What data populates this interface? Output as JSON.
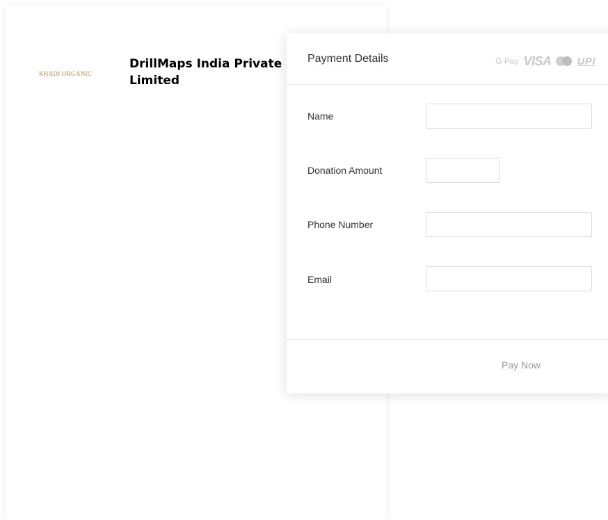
{
  "merchant": {
    "logo_text": "KHADI ORGANIC",
    "name": "DrillMaps India Private Limited"
  },
  "payment": {
    "title": "Payment Details",
    "methods": [
      {
        "label": "G Pay",
        "icon": "gpay-icon"
      },
      {
        "label": "VISA",
        "icon": "visa-icon"
      },
      {
        "label": "",
        "icon": "mastercard-icon"
      },
      {
        "label": "UPI",
        "icon": "upi-icon"
      }
    ],
    "fields": {
      "name": {
        "label": "Name",
        "value": "",
        "placeholder": ""
      },
      "amount": {
        "label": "Donation Amount",
        "value": "",
        "placeholder": ""
      },
      "phone": {
        "label": "Phone Number",
        "value": "",
        "placeholder": ""
      },
      "email": {
        "label": "Email",
        "value": "",
        "placeholder": ""
      }
    },
    "pay_button": "Pay Now"
  },
  "colors": {
    "logo": "#b8864e",
    "muted_text": "#9a9a9a",
    "border": "#dcdcdc"
  }
}
